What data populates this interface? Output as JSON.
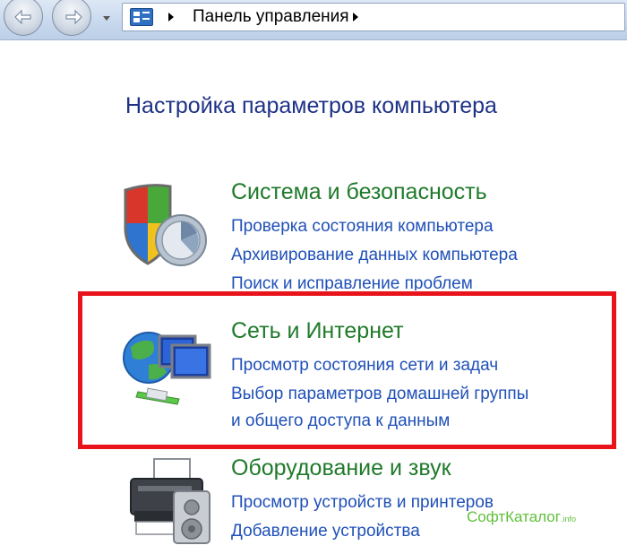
{
  "address_bar": {
    "breadcrumb": "Панель управления"
  },
  "page_title": "Настройка параметров компьютера",
  "categories": [
    {
      "heading": "Система и безопасность",
      "icon": "shield-icon",
      "links": [
        "Проверка состояния компьютера",
        "Архивирование данных компьютера",
        "Поиск и исправление проблем"
      ]
    },
    {
      "heading": "Сеть и Интернет",
      "icon": "network-globe-icon",
      "links": [
        "Просмотр состояния сети и задач",
        "Выбор параметров домашней группы",
        "и общего доступа к данным"
      ]
    },
    {
      "heading": "Оборудование и звук",
      "icon": "printer-speaker-icon",
      "links": [
        "Просмотр устройств и принтеров",
        "Добавление устройства"
      ]
    }
  ],
  "watermark": {
    "text": "СофтКаталог",
    "suffix": ".info"
  },
  "colors": {
    "title": "#1e3287",
    "heading": "#1f7a2a",
    "link": "#1f50b8",
    "highlight": "#e8131b"
  }
}
